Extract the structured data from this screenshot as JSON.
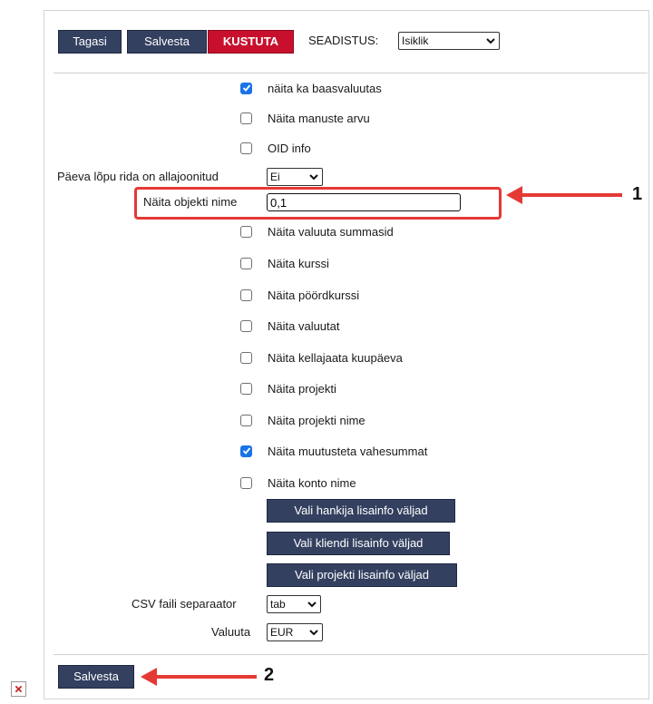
{
  "toolbar": {
    "back_label": "Tagasi",
    "save_label": "Salvesta",
    "delete_label": "KUSTUTA",
    "setting_label": "SEADISTUS:",
    "setting_value": "Isiklik"
  },
  "checkboxes": [
    {
      "label": "näita ka baasvaluutas",
      "checked": true
    },
    {
      "label": "Näita manuste arvu",
      "checked": false
    },
    {
      "label": "OID info",
      "checked": false
    }
  ],
  "day_end_row": {
    "label": "Päeva lõpu rida on allajoonitud",
    "value": "Ei"
  },
  "object_name": {
    "label": "Näita objekti nime",
    "value": "0,1"
  },
  "checkboxes2": [
    {
      "label": "Näita valuuta summasid",
      "checked": false
    },
    {
      "label": "Näita kurssi",
      "checked": false
    },
    {
      "label": "Näita pöördkurssi",
      "checked": false
    },
    {
      "label": "Näita valuutat",
      "checked": false
    },
    {
      "label": "Näita kellajaata kuupäeva",
      "checked": false
    },
    {
      "label": "Näita projekti",
      "checked": false
    },
    {
      "label": "Näita projekti nime",
      "checked": false
    },
    {
      "label": "Näita muutusteta vahesummat",
      "checked": true
    },
    {
      "label": "Näita konto nime",
      "checked": false
    }
  ],
  "extra_buttons": [
    "Vali hankija lisainfo väljad",
    "Vali kliendi lisainfo väljad",
    "Vali projekti lisainfo väljad"
  ],
  "csv": {
    "label": "CSV faili separaator",
    "value": "tab"
  },
  "currency": {
    "label": "Valuuta",
    "value": "EUR"
  },
  "footer": {
    "save_label": "Salvesta"
  },
  "annotations": {
    "one": "1",
    "two": "2",
    "color": "#e53935"
  },
  "colors": {
    "button": "#34405f",
    "danger": "#c8102e",
    "check": "#1a73e8"
  }
}
